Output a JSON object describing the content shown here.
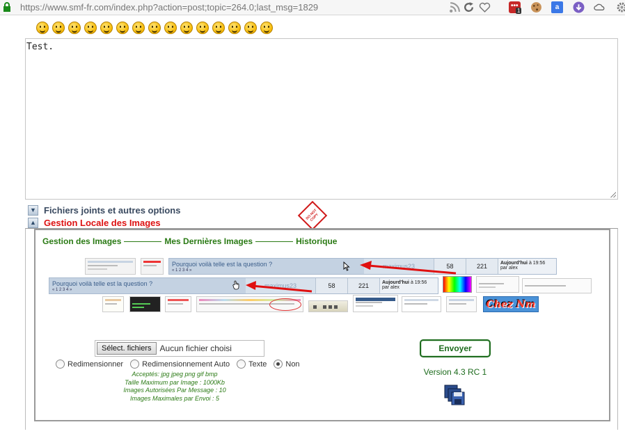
{
  "browser": {
    "url": "https://www.smf-fr.com/index.php?action=post;topic=264.0;last_msg=1829",
    "toolbar_badge": "1",
    "icons": [
      "lock-icon",
      "rss-icon",
      "reload-icon",
      "bookmark-heart-icon",
      "extension-red-icon",
      "cookie-icon",
      "translate-icon",
      "download-icon",
      "cloud-icon",
      "settings-gear-icon"
    ]
  },
  "editor": {
    "message_text": "Test.",
    "smiley_count": 15
  },
  "sections": {
    "attachments_label": "Fichiers joints et autres options",
    "local_images_label": "Gestion Locale des Images"
  },
  "stamp": {
    "line1": "DO NOT",
    "line2": "COPY"
  },
  "image_manager": {
    "tabs": [
      "Gestion des Images",
      "Mes Dernières Images",
      "Historique"
    ],
    "topic_rows": [
      {
        "title": "Pourquoi voilà telle est la question ?",
        "pages": "« 1 2 3 4 »",
        "author": "maximus23",
        "replies": "58",
        "views": "221",
        "last_when": "Aujourd'hui",
        "last_time": "à 19:56",
        "last_by": "par alex"
      },
      {
        "title": "Pourquoi voilà telle est la question ?",
        "pages": "« 1 2 3 4 »",
        "author": "maximus23",
        "replies": "58",
        "views": "221",
        "last_when": "Aujourd'hui",
        "last_time": "à 19:56",
        "last_by": "par alex"
      }
    ],
    "thumb_text": "Chez Nm"
  },
  "upload": {
    "file_button": "Sélect. fichiers",
    "file_status": "Aucun fichier choisi",
    "options": [
      {
        "label": "Redimensionner",
        "selected": false
      },
      {
        "label": "Redimensionnement Auto",
        "selected": false
      },
      {
        "label": "Texte",
        "selected": false
      },
      {
        "label": "Non",
        "selected": true
      }
    ],
    "rules": [
      "Acceptés: jpg jpeg png gif bmp",
      "Taille Maximum par Image : 1000Kb",
      "Images Autorisées Par Message : 10",
      "Images Maximales par Envoi : 5"
    ],
    "send_label": "Envoyer",
    "version": "Version 4.3 RC 1"
  },
  "colors": {
    "green": "#2a7a14",
    "red_label": "#dd1111",
    "topic_blue": "#c4d2e2",
    "arrow_red": "#e01010"
  }
}
